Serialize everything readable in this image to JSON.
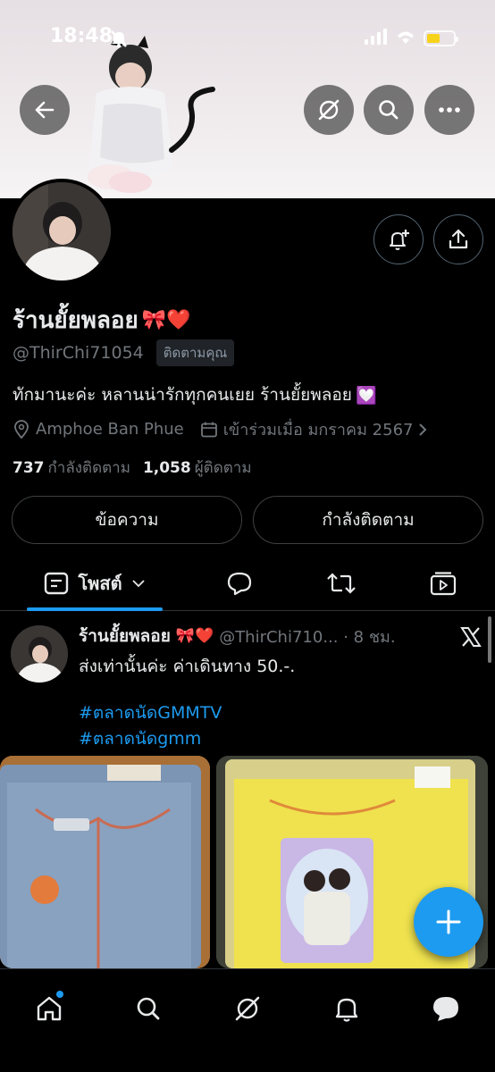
{
  "status_bar": {
    "time": "18:48"
  },
  "header": {
    "back_icon": "arrow-left-icon",
    "grok_icon": "grok-icon",
    "search_icon": "search-icon",
    "more_icon": "ellipsis-icon"
  },
  "profile": {
    "display_name": "ร้านยั้ยพลอย",
    "emoji": "🎀❤️",
    "handle": "@ThirChi71054",
    "follows_you_badge": "ติดตามคุณ",
    "bio": "ทักมานะค่ะ หลานน่ารักทุกคนเยย ร้านยั้ยพลอย",
    "bio_emoji": "💟",
    "location": "Amphoe Ban Phue",
    "joined": "เข้าร่วมเมื่อ มกราคม 2567",
    "following_count": "737",
    "following_label": "กำลังติดตาม",
    "followers_count": "1,058",
    "followers_label": "ผู้ติดตาม",
    "message_button": "ข้อความ",
    "following_button": "กำลังติดตาม"
  },
  "tabs": {
    "posts_label": "โพสต์"
  },
  "post": {
    "author_name": "ร้านยั้ยพลอย",
    "author_emoji": "🎀❤️",
    "handle_time": "@ThirChi710... · 8 ชม.",
    "text": "ส่งเท่านั้นค่ะ ค่าเดินทาง 50.-.",
    "hashtags": [
      "#ตลาดนัดGMMTV",
      "#ตลาดนัดgmm"
    ]
  },
  "colors": {
    "accent": "#1d9bf0",
    "background": "#000000",
    "muted": "#71767b"
  }
}
